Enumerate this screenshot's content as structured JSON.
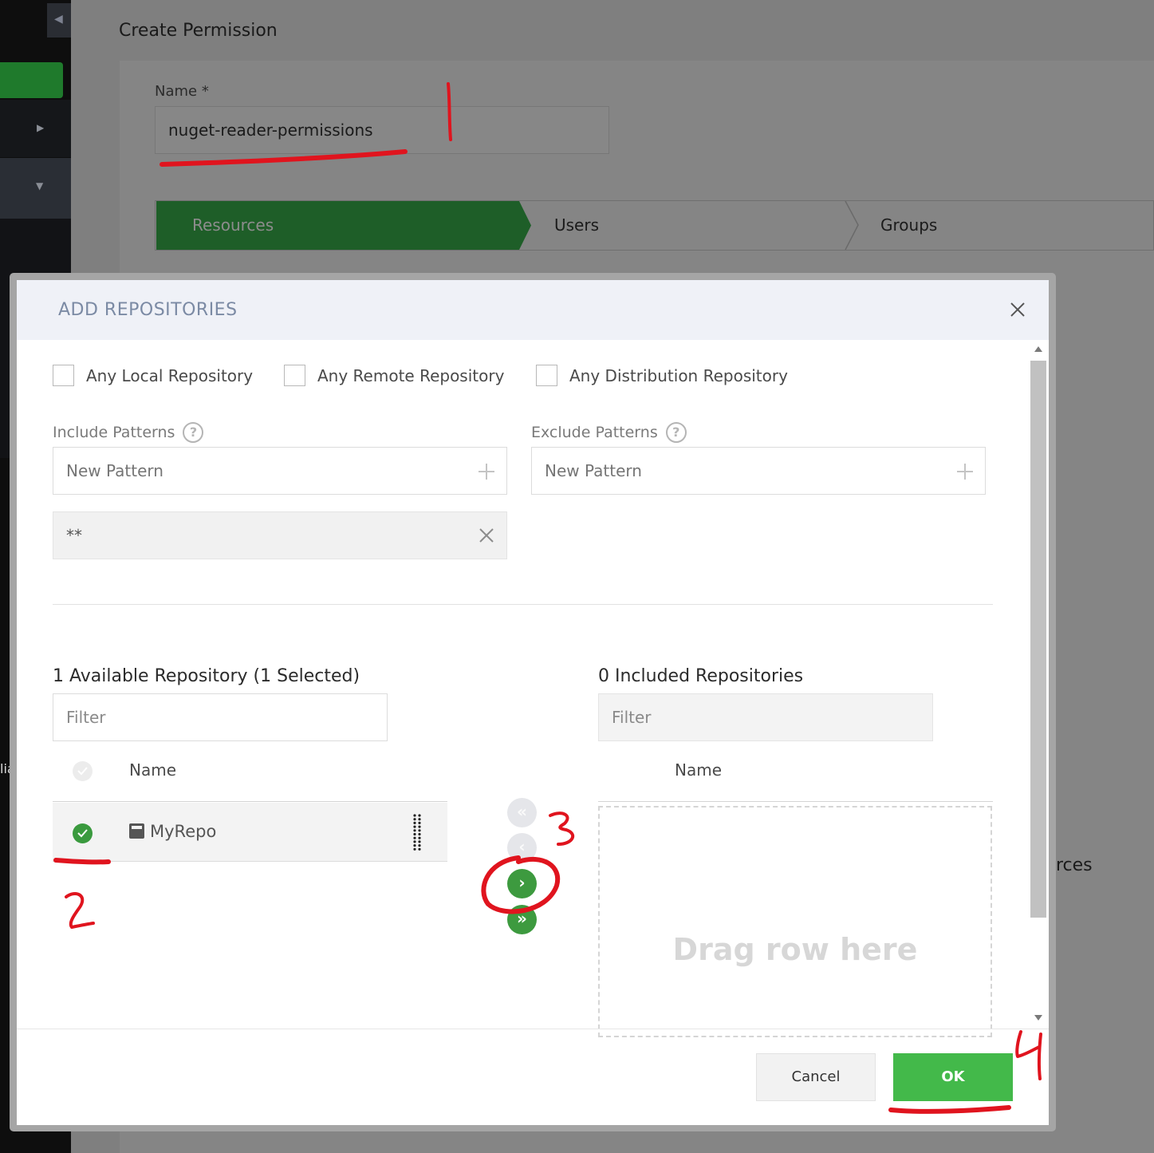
{
  "page": {
    "title": "Create Permission",
    "name_label": "Name *",
    "name_value": "nuget-reader-permissions",
    "steps": [
      "Resources",
      "Users",
      "Groups"
    ],
    "behind_text": "urces",
    "sidebar_fragment": "lia"
  },
  "modal": {
    "title": "ADD REPOSITORIES",
    "checkboxes": [
      "Any Local Repository",
      "Any Remote Repository",
      "Any Distribution Repository"
    ],
    "include_label": "Include Patterns",
    "exclude_label": "Exclude Patterns",
    "include_placeholder": "New Pattern",
    "exclude_placeholder": "New Pattern",
    "include_patterns": [
      "**"
    ],
    "available_title": "1 Available Repository (1 Selected)",
    "included_title": "0 Included Repositories",
    "filter_placeholder": "Filter",
    "column_name": "Name",
    "available_rows": [
      {
        "name": "MyRepo",
        "selected": true
      }
    ],
    "drop_text": "Drag row here",
    "move_buttons": [
      "«",
      "‹",
      "›",
      "»"
    ],
    "cancel_label": "Cancel",
    "ok_label": "OK"
  },
  "annotations": [
    "1",
    "2",
    "3",
    "4"
  ],
  "colors": {
    "accent_green": "#43b94a",
    "step_green": "#1e5e28",
    "annotation_red": "#e0141e",
    "modal_title": "#7b8aa4"
  }
}
